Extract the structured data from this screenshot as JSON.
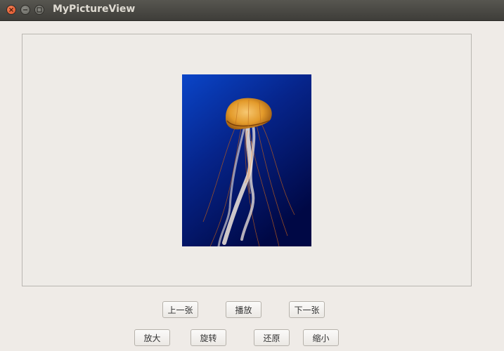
{
  "window": {
    "title": "MyPictureView",
    "controls": [
      "close-icon",
      "minimize-icon",
      "maximize-icon"
    ]
  },
  "viewer": {
    "image_subject": "jellyfish",
    "colors": {
      "background_top": "#0a3fc0",
      "background_bottom": "#000a45",
      "jellyfish": "#e39a2a"
    }
  },
  "buttons": {
    "prev": "上一张",
    "play": "播放",
    "next": "下一张",
    "zoom_in": "放大",
    "rotate": "旋转",
    "restore": "还原",
    "zoom_out": "缩小"
  }
}
